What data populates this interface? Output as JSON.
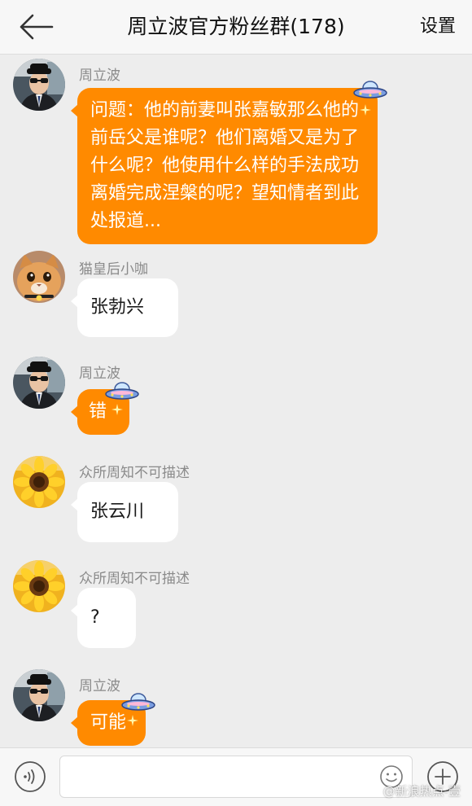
{
  "header": {
    "title": "周立波官方粉丝群(178)",
    "settings_label": "设置"
  },
  "messages": [
    {
      "sender": "周立波",
      "text": "问题：他的前妻叫张嘉敏那么他的前岳父是谁呢？他们离婚又是为了什么呢？他使用什么样的手法成功离婚完成涅槃的呢？望知情者到此处报道...",
      "style": "orange",
      "avatar": "man-sunglasses-avatar",
      "decoration": "ufo-icon"
    },
    {
      "sender": "猫皇后小咖",
      "text": "张勃兴",
      "style": "white",
      "avatar": "cat-avatar"
    },
    {
      "sender": "周立波",
      "text": "错",
      "style": "orange",
      "avatar": "man-sunglasses-avatar",
      "decoration": "ufo-icon"
    },
    {
      "sender": "众所周知不可描述",
      "text": "张云川",
      "style": "white",
      "avatar": "sunflower-avatar"
    },
    {
      "sender": "众所周知不可描述",
      "text": "?",
      "style": "white",
      "avatar": "sunflower-avatar"
    },
    {
      "sender": "周立波",
      "text": "可能",
      "style": "orange",
      "avatar": "man-sunglasses-avatar",
      "decoration": "ufo-icon"
    }
  ],
  "bottom_bar": {
    "input_value": "",
    "icons": [
      "voice-icon",
      "emoji-icon",
      "plus-icon"
    ]
  },
  "watermark": "@新浪热点-壹",
  "colors": {
    "accent": "#ff8a00",
    "background": "#ededed",
    "bar": "#f7f7f7"
  }
}
